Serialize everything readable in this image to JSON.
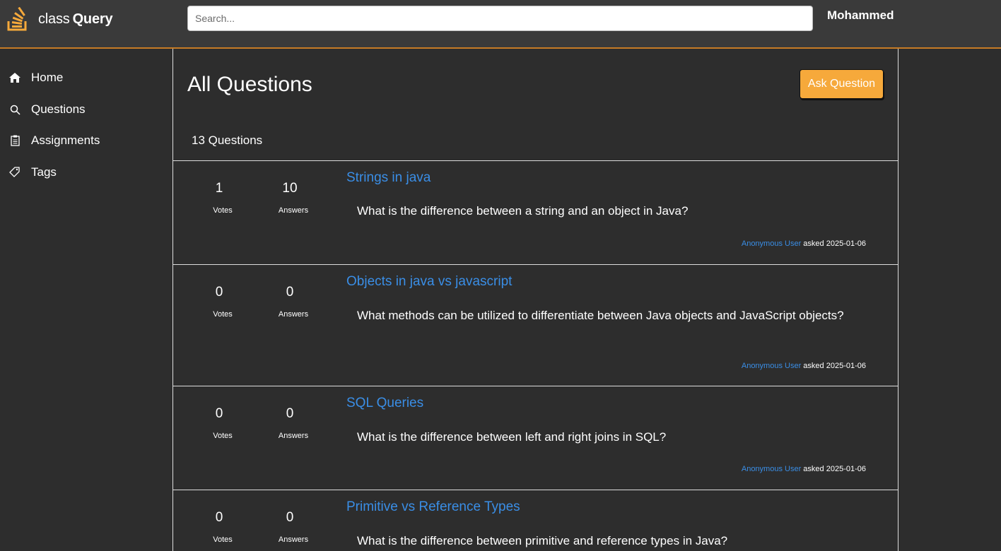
{
  "app": {
    "logo_text_a": "class",
    "logo_text_b": "Query",
    "accent_color": "#f6a93b",
    "link_color": "#3a8ee6"
  },
  "header": {
    "search_placeholder": "Search...",
    "user_name": "Mohammed"
  },
  "sidebar": {
    "items": [
      {
        "label": "Home",
        "icon": "home-icon"
      },
      {
        "label": "Questions",
        "icon": "search-icon"
      },
      {
        "label": "Assignments",
        "icon": "clipboard-icon"
      },
      {
        "label": "Tags",
        "icon": "tag-icon"
      }
    ]
  },
  "main": {
    "title": "All Questions",
    "ask_button": "Ask Question",
    "question_count": "13 Questions",
    "votes_caption": "Votes",
    "answers_caption": "Answers",
    "asked_word": "asked",
    "questions": [
      {
        "votes": "1",
        "answers": "10",
        "title": "Strings in java",
        "text": "What is the difference between a string and an object in Java?",
        "author": "Anonymous User",
        "date": "2025-01-06"
      },
      {
        "votes": "0",
        "answers": "0",
        "title": "Objects in java vs javascript",
        "text": "What methods can be utilized to differentiate between Java objects and JavaScript objects?",
        "author": "Anonymous User",
        "date": "2025-01-06"
      },
      {
        "votes": "0",
        "answers": "0",
        "title": "SQL Queries",
        "text": "What is the difference between left and right joins in SQL?",
        "author": "Anonymous User",
        "date": "2025-01-06"
      },
      {
        "votes": "0",
        "answers": "0",
        "title": "Primitive vs Reference Types",
        "text": "What is the difference between primitive and reference types in Java?",
        "author": "",
        "date": ""
      }
    ]
  }
}
